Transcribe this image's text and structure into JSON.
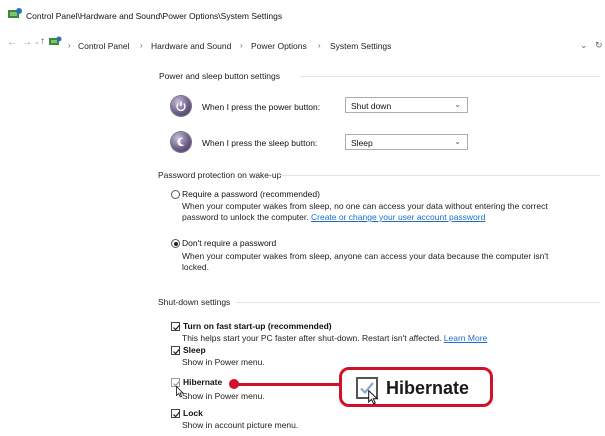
{
  "window": {
    "title": "Control Panel\\Hardware and Sound\\Power Options\\System Settings"
  },
  "address": {
    "crumbs": [
      "Control Panel",
      "Hardware and Sound",
      "Power Options",
      "System Settings"
    ],
    "separator": "›",
    "back_icon": "back-arrow-icon",
    "forward_icon": "forward-arrow-icon",
    "up_icon": "up-arrow-icon"
  },
  "power_buttons": {
    "heading": "Power and sleep button settings",
    "power_label": "When I press the power button:",
    "power_value": "Shut down",
    "sleep_label": "When I press the sleep button:",
    "sleep_value": "Sleep"
  },
  "password": {
    "heading": "Password protection on wake-up",
    "require_label": "Require a password (recommended)",
    "require_desc_1": "When your computer wakes from sleep, no one can access your data without entering the correct",
    "require_desc_2": "password to unlock the computer.",
    "require_link": "Create or change your user account password",
    "norequire_label": "Don't require a password",
    "norequire_desc_1": "When your computer wakes from sleep, anyone can access your data because the computer isn't",
    "norequire_desc_2": "locked.",
    "selected": "norequire"
  },
  "shutdown": {
    "heading": "Shut-down settings",
    "items": [
      {
        "label": "Turn on fast start-up (recommended)",
        "desc": "This helps start your PC faster after shut-down. Restart isn't affected.",
        "link": "Learn More",
        "checked": true
      },
      {
        "label": "Sleep",
        "desc": "Show in Power menu.",
        "checked": true
      },
      {
        "label": "Hibernate",
        "desc": "Show in Power menu.",
        "checked": true
      },
      {
        "label": "Lock",
        "desc": "Show in account picture menu.",
        "checked": true
      }
    ]
  },
  "callout": {
    "label": "Hibernate",
    "color": "#d1102a"
  },
  "colors": {
    "link": "#1a6fc9",
    "accent_red": "#d1102a"
  }
}
